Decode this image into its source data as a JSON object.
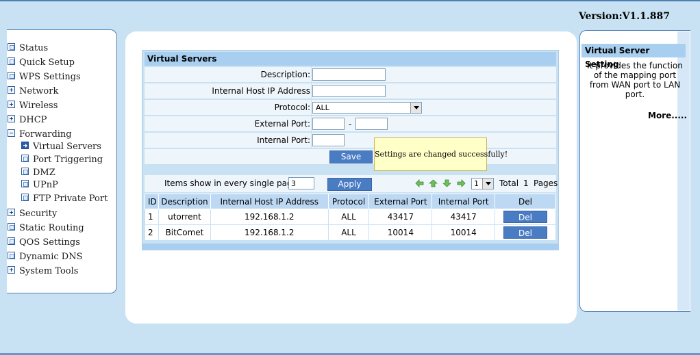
{
  "version": "Version:V1.1.887",
  "sidebar": {
    "items": [
      {
        "label": "Status",
        "icon": "page-icon"
      },
      {
        "label": "Quick Setup",
        "icon": "page-icon"
      },
      {
        "label": "WPS Settings",
        "icon": "page-icon"
      },
      {
        "label": "Network",
        "icon": "plus-icon"
      },
      {
        "label": "Wireless",
        "icon": "plus-icon"
      },
      {
        "label": "DHCP",
        "icon": "plus-icon"
      },
      {
        "label": "Forwarding",
        "icon": "minus-icon"
      },
      {
        "label": "Virtual Servers",
        "icon": "arrow-icon"
      },
      {
        "label": "Port Triggering",
        "icon": "page-icon"
      },
      {
        "label": "DMZ",
        "icon": "page-icon"
      },
      {
        "label": "UPnP",
        "icon": "page-icon"
      },
      {
        "label": "FTP Private Port",
        "icon": "page-icon"
      },
      {
        "label": "Security",
        "icon": "plus-icon"
      },
      {
        "label": "Static Routing",
        "icon": "page-icon"
      },
      {
        "label": "QOS Settings",
        "icon": "page-icon"
      },
      {
        "label": "Dynamic DNS",
        "icon": "page-icon"
      },
      {
        "label": "System Tools",
        "icon": "plus-icon"
      }
    ]
  },
  "form": {
    "title": "Virtual Servers",
    "description_label": "Description:",
    "description_value": "",
    "internal_ip_label": "Internal Host IP Address",
    "internal_ip_value": "",
    "protocol_label": "Protocol:",
    "protocol_value": "ALL",
    "external_port_label": "External Port:",
    "external_port_from": "",
    "port_dash": "-",
    "external_port_to": "",
    "internal_port_label": "Internal Port:",
    "internal_port_value": "",
    "save_label": "Save",
    "tooltip": "Settings are changed successfully!"
  },
  "pager": {
    "items_label": "Items show in every single page",
    "items_value": "3",
    "apply_label": "Apply",
    "page_value": "1",
    "total_label": "Total",
    "total_pages": "1",
    "pages_label": "Pages"
  },
  "table": {
    "headers": [
      "ID",
      "Description",
      "Internal Host IP Address",
      "Protocol",
      "External Port",
      "Internal Port",
      "Del"
    ],
    "rows": [
      {
        "id": "1",
        "description": "utorrent",
        "ip": "192.168.1.2",
        "protocol": "ALL",
        "external": "43417",
        "internal": "43417",
        "del": "Del"
      },
      {
        "id": "2",
        "description": "BitComet",
        "ip": "192.168.1.2",
        "protocol": "ALL",
        "external": "10014",
        "internal": "10014",
        "del": "Del"
      }
    ]
  },
  "help": {
    "title": "Virtual Server Setting",
    "text": "It provides the function of the mapping port from WAN port to LAN port.",
    "more": "More....."
  },
  "colors": {
    "background": "#c8e2f4",
    "header": "#a9cff0",
    "button": "#4a7cc4"
  }
}
